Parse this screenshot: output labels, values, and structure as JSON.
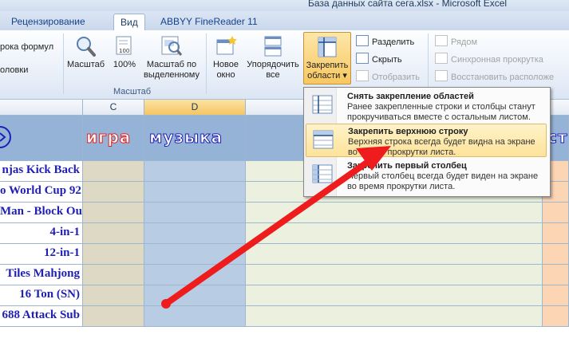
{
  "window": {
    "title": "База данных сайта сега.xlsx  -  Microsoft Excel"
  },
  "tabs": [
    {
      "label": "Рецензирование"
    },
    {
      "label": "Вид"
    },
    {
      "label": "ABBYY FineReader 11"
    }
  ],
  "ribbon": {
    "left_clipped": [
      "рока формул",
      "оловки"
    ],
    "buttons": {
      "zoom": "Масштаб",
      "zoom100": "100%",
      "zoom_selection_line1": "Масштаб по",
      "zoom_selection_line2": "выделенному",
      "new_window_line1": "Новое",
      "new_window_line2": "окно",
      "arrange_all_line1": "Упорядочить",
      "arrange_all_line2": "все",
      "freeze_panes_line1": "Закрепить",
      "freeze_panes_line2": "области ▾"
    },
    "zoom_group_label": "Масштаб",
    "window_small": {
      "split": "Разделить",
      "hide": "Скрыть",
      "unhide": "Отобразить",
      "side_by_side": "Рядом",
      "sync_scroll": "Синхронная прокрутка",
      "reset_position": "Восстановить расположе"
    }
  },
  "freeze_menu": {
    "items": [
      {
        "title": "Снять закрепление областей",
        "desc": "Ранее закрепленные строки и столбцы станут прокручиваться вместе с остальным листом."
      },
      {
        "title": "Закрепить верхнюю строку",
        "desc": "Верхняя строка всегда будет видна на экране во время прокрутки листа."
      },
      {
        "title": "Закрепить первый столбец",
        "desc": "Первый столбец всегда будет виден на экране во время прокрутки листа."
      }
    ]
  },
  "sheet": {
    "columns": [
      "C",
      "D"
    ],
    "header_cells": {
      "col_c": "игра",
      "col_d": "музыка",
      "right_clip": "ст"
    },
    "rows": [
      "njas Kick Back",
      "o World Cup 92",
      "Man - Block Out",
      "4-in-1",
      "12-in-1",
      "Tiles Mahjong",
      "16 Ton (SN)",
      "688 Attack Sub"
    ]
  },
  "colors": {
    "header_row": "#95b3d7",
    "col_c": "#ddd9c4",
    "col_d": "#b8cce4",
    "col_e": "#ebf1de",
    "col_f": "#fcd5b4",
    "names": "#1f1fb6",
    "arrow": "#ee1c1c"
  }
}
